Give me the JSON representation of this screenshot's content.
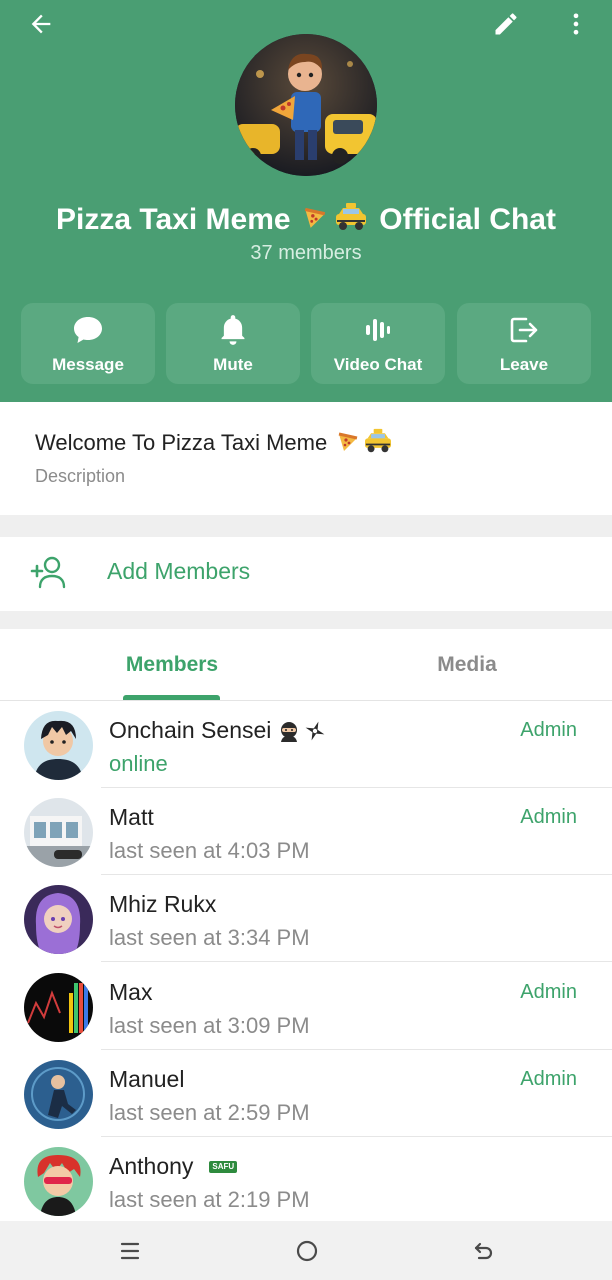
{
  "header": {
    "title": "Pizza Taxi Meme",
    "title_suffix": "Official Chat",
    "members_count": "37 members",
    "accent_color": "#4a9e73"
  },
  "actions": [
    {
      "label": "Message",
      "icon": "message-icon"
    },
    {
      "label": "Mute",
      "icon": "bell-icon"
    },
    {
      "label": "Video Chat",
      "icon": "voice-chat-icon"
    },
    {
      "label": "Leave",
      "icon": "leave-icon"
    }
  ],
  "description": {
    "text": "Welcome To Pizza Taxi Meme",
    "label": "Description"
  },
  "add_members": {
    "label": "Add Members",
    "icon": "add-user-icon"
  },
  "tabs": [
    {
      "label": "Members",
      "active": true
    },
    {
      "label": "Media",
      "active": false
    }
  ],
  "members": [
    {
      "name": "Onchain Sensei",
      "status": "online",
      "role": "Admin"
    },
    {
      "name": "Matt",
      "status": "last seen at 4:03 PM",
      "role": "Admin"
    },
    {
      "name": "Mhiz Rukx",
      "status": "last seen at 3:34 PM",
      "role": ""
    },
    {
      "name": "Max",
      "status": "last seen at 3:09 PM",
      "role": "Admin"
    },
    {
      "name": "Manuel",
      "status": "last seen at 2:59 PM",
      "role": "Admin"
    },
    {
      "name": "Anthony",
      "status": "last seen at 2:19 PM",
      "role": "",
      "badge": "SAFU"
    }
  ],
  "colors": {
    "green": "#3da36b",
    "grey_text": "#8b8b8b"
  }
}
